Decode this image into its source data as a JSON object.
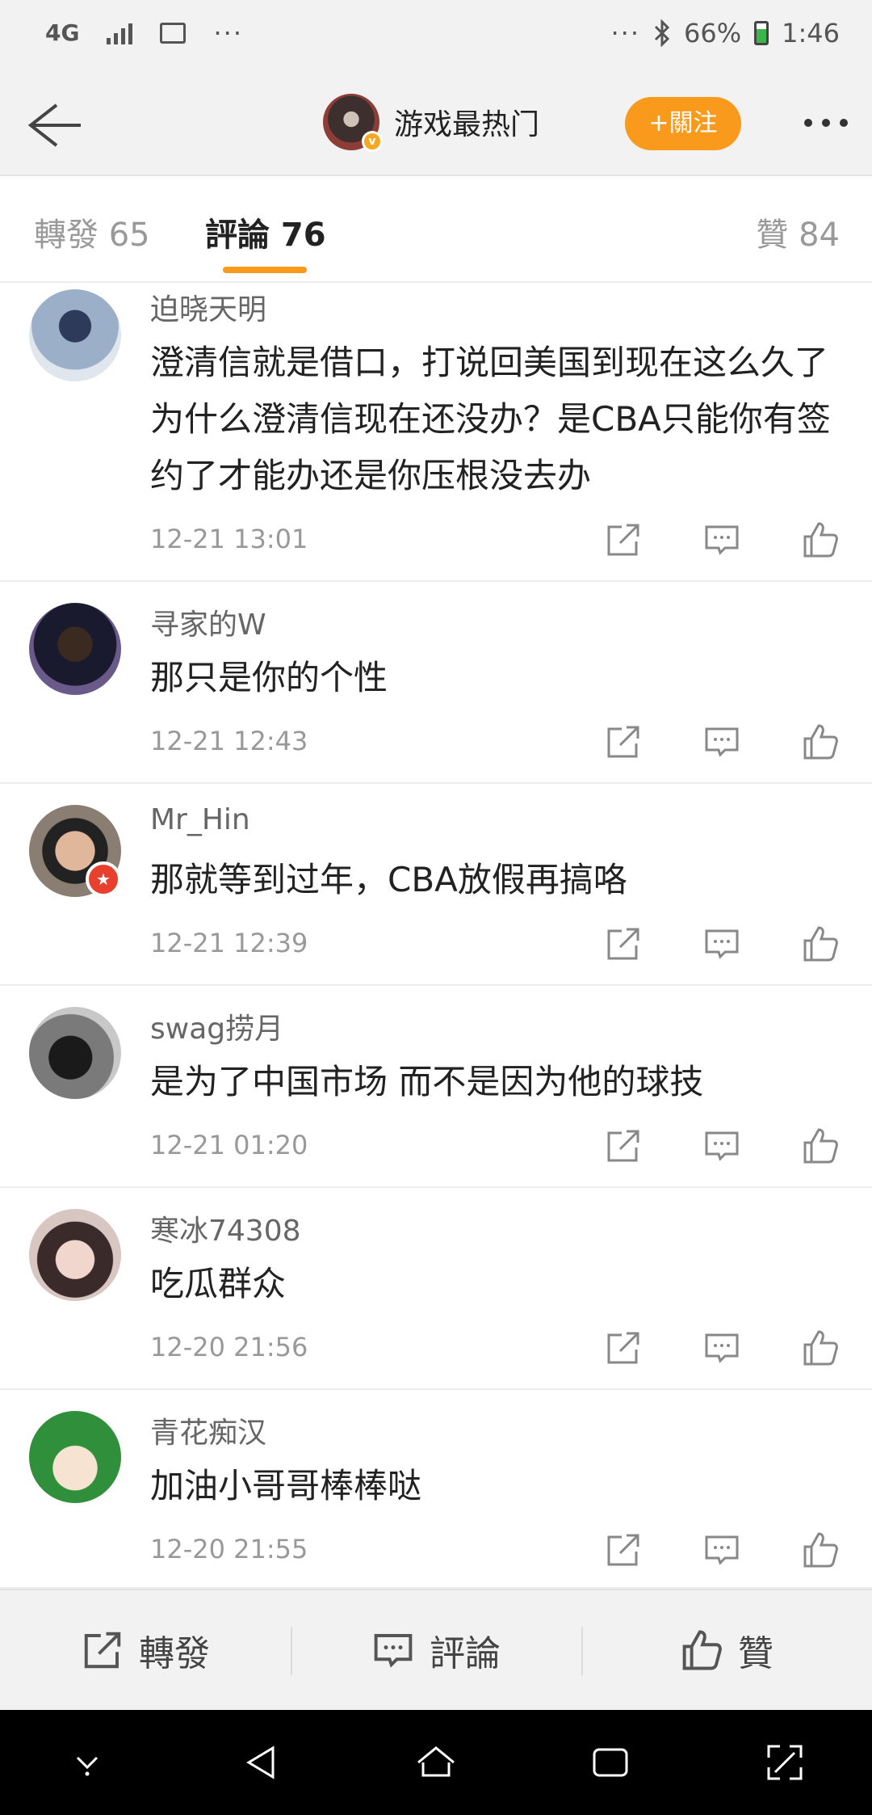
{
  "status_bar": {
    "network": "4G",
    "dots_left": "···",
    "dots_right": "···",
    "battery": "66%",
    "time": "1:46"
  },
  "header": {
    "account_name": "游戏最热门",
    "follow_label": "+關注",
    "verified_mark": "v"
  },
  "tabs": [
    {
      "label": "轉發 65"
    },
    {
      "label": "評論 76"
    },
    {
      "label": "贊 84"
    }
  ],
  "comments": [
    {
      "user": "迫晓天明",
      "text": "澄清信就是借口，打说回美国到现在这么久了为什么澄清信现在还没办？是CBA只能你有签约了才能办还是你压根没去办",
      "time": "12-21 13:01"
    },
    {
      "user": "寻家的W",
      "text": "那只是你的个性",
      "time": "12-21 12:43"
    },
    {
      "user": "Mr_Hin",
      "text": "那就等到过年，CBA放假再搞咯",
      "time": "12-21 12:39"
    },
    {
      "user": "swag捞月",
      "text": "是为了中国市场 而不是因为他的球技",
      "time": "12-21 01:20"
    },
    {
      "user": "寒冰74308",
      "text": "吃瓜群众",
      "time": "12-20 21:56"
    },
    {
      "user": "青花痴汉",
      "text": "加油小哥哥棒棒哒",
      "time": "12-20 21:55"
    }
  ],
  "bottom_bar": {
    "repost": "轉發",
    "comment": "評論",
    "like": "贊"
  },
  "colors": {
    "accent": "#f99a1c",
    "badge_red": "#e8402e"
  }
}
